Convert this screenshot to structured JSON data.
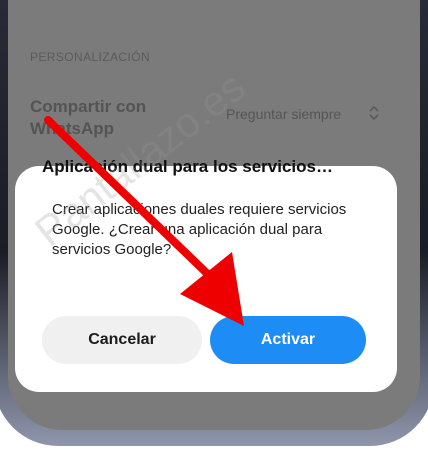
{
  "settings": {
    "section_header": "PERSONALIZACIÓN",
    "share_title": "Compartir con WhatsApp",
    "share_value": "Preguntar siempre",
    "share_value_icon": "chevron-up-down-icon"
  },
  "dialog": {
    "title": "Aplicación dual para los servicios…",
    "message": "Crear aplicaciones duales requiere servicios Google. ¿Crear una aplicación dual para servicios Google?",
    "cancel_label": "Cancelar",
    "activate_label": "Activar"
  },
  "overlay": {
    "watermark": "Pantallazo.es",
    "arrow_color": "#ee0000"
  },
  "colors": {
    "accent": "#1e8cf5",
    "dim_background": "#7b7b7b"
  }
}
